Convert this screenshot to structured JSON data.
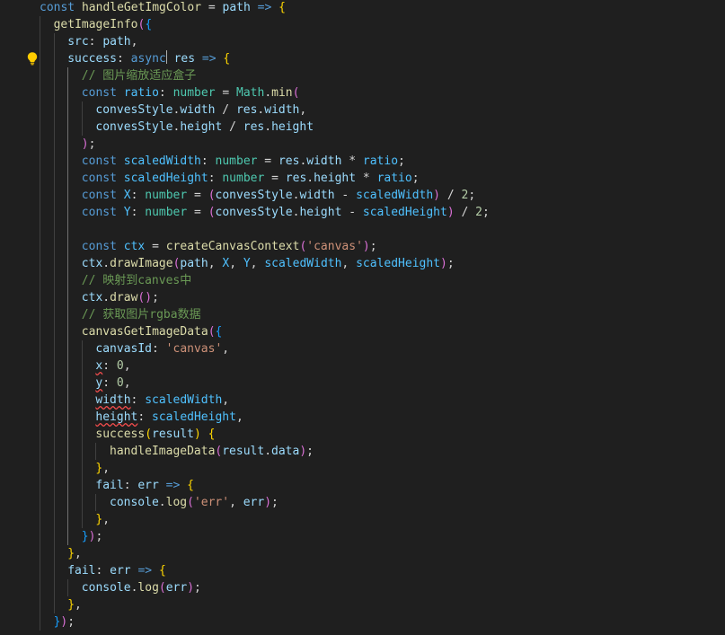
{
  "editor": {
    "theme": "dark",
    "colors": {
      "background": "#1f1f1f",
      "keyword": "#569cd6",
      "function": "#dcdcaa",
      "variable": "#9cdcfe",
      "string": "#ce9178",
      "number": "#b5cea8",
      "comment": "#6a9955",
      "type": "#4ec9b0",
      "bracket_level_1": "#ffd700",
      "bracket_level_2": "#da70d6",
      "bracket_level_3": "#179fff"
    },
    "gutter_icon": "lightbulb-icon",
    "lines": [
      {
        "indent": 0,
        "t": [
          [
            "kw",
            "const "
          ],
          [
            "fn",
            "handleGetImgColor"
          ],
          [
            "op",
            " = "
          ],
          [
            "var",
            "path"
          ],
          [
            "kw",
            " => "
          ],
          [
            "b1",
            "{"
          ]
        ]
      },
      {
        "indent": 1,
        "t": [
          [
            "fn",
            "getImageInfo"
          ],
          [
            "b2",
            "("
          ],
          [
            "b3",
            "{"
          ]
        ]
      },
      {
        "indent": 2,
        "t": [
          [
            "var",
            "src"
          ],
          [
            "op",
            ": "
          ],
          [
            "var",
            "path"
          ],
          [
            "op",
            ","
          ]
        ]
      },
      {
        "indent": 2,
        "t": [
          [
            "var",
            "success"
          ],
          [
            "op",
            ": "
          ],
          [
            "kw",
            "async"
          ],
          [
            "cur",
            ""
          ],
          [
            "op",
            " "
          ],
          [
            "var",
            "res"
          ],
          [
            "kw",
            " => "
          ],
          [
            "b1",
            "{"
          ]
        ]
      },
      {
        "indent": 3,
        "t": [
          [
            "cm",
            "// 图片缩放适应盒子"
          ]
        ]
      },
      {
        "indent": 3,
        "t": [
          [
            "kw",
            "const "
          ],
          [
            "const",
            "ratio"
          ],
          [
            "op",
            ": "
          ],
          [
            "type",
            "number"
          ],
          [
            "op",
            " = "
          ],
          [
            "type",
            "Math"
          ],
          [
            "op",
            "."
          ],
          [
            "fn",
            "min"
          ],
          [
            "b2",
            "("
          ]
        ]
      },
      {
        "indent": 4,
        "t": [
          [
            "var",
            "convesStyle"
          ],
          [
            "op",
            "."
          ],
          [
            "var",
            "width"
          ],
          [
            "op",
            " / "
          ],
          [
            "var",
            "res"
          ],
          [
            "op",
            "."
          ],
          [
            "var",
            "width"
          ],
          [
            "op",
            ","
          ]
        ]
      },
      {
        "indent": 4,
        "t": [
          [
            "var",
            "convesStyle"
          ],
          [
            "op",
            "."
          ],
          [
            "var",
            "height"
          ],
          [
            "op",
            " / "
          ],
          [
            "var",
            "res"
          ],
          [
            "op",
            "."
          ],
          [
            "var",
            "height"
          ]
        ]
      },
      {
        "indent": 3,
        "t": [
          [
            "b2",
            ")"
          ],
          [
            "op",
            ";"
          ]
        ]
      },
      {
        "indent": 3,
        "t": [
          [
            "kw",
            "const "
          ],
          [
            "const",
            "scaledWidth"
          ],
          [
            "op",
            ": "
          ],
          [
            "type",
            "number"
          ],
          [
            "op",
            " = "
          ],
          [
            "var",
            "res"
          ],
          [
            "op",
            "."
          ],
          [
            "var",
            "width"
          ],
          [
            "op",
            " * "
          ],
          [
            "const",
            "ratio"
          ],
          [
            "op",
            ";"
          ]
        ]
      },
      {
        "indent": 3,
        "t": [
          [
            "kw",
            "const "
          ],
          [
            "const",
            "scaledHeight"
          ],
          [
            "op",
            ": "
          ],
          [
            "type",
            "number"
          ],
          [
            "op",
            " = "
          ],
          [
            "var",
            "res"
          ],
          [
            "op",
            "."
          ],
          [
            "var",
            "height"
          ],
          [
            "op",
            " * "
          ],
          [
            "const",
            "ratio"
          ],
          [
            "op",
            ";"
          ]
        ]
      },
      {
        "indent": 3,
        "t": [
          [
            "kw",
            "const "
          ],
          [
            "const",
            "X"
          ],
          [
            "op",
            ": "
          ],
          [
            "type",
            "number"
          ],
          [
            "op",
            " = "
          ],
          [
            "b2",
            "("
          ],
          [
            "var",
            "convesStyle"
          ],
          [
            "op",
            "."
          ],
          [
            "var",
            "width"
          ],
          [
            "op",
            " - "
          ],
          [
            "const",
            "scaledWidth"
          ],
          [
            "b2",
            ")"
          ],
          [
            "op",
            " / "
          ],
          [
            "num",
            "2"
          ],
          [
            "op",
            ";"
          ]
        ]
      },
      {
        "indent": 3,
        "t": [
          [
            "kw",
            "const "
          ],
          [
            "const",
            "Y"
          ],
          [
            "op",
            ": "
          ],
          [
            "type",
            "number"
          ],
          [
            "op",
            " = "
          ],
          [
            "b2",
            "("
          ],
          [
            "var",
            "convesStyle"
          ],
          [
            "op",
            "."
          ],
          [
            "var",
            "height"
          ],
          [
            "op",
            " - "
          ],
          [
            "const",
            "scaledHeight"
          ],
          [
            "b2",
            ")"
          ],
          [
            "op",
            " / "
          ],
          [
            "num",
            "2"
          ],
          [
            "op",
            ";"
          ]
        ]
      },
      {
        "indent": 3,
        "t": []
      },
      {
        "indent": 3,
        "t": [
          [
            "kw",
            "const "
          ],
          [
            "const",
            "ctx"
          ],
          [
            "op",
            " = "
          ],
          [
            "fn",
            "createCanvasContext"
          ],
          [
            "b2",
            "("
          ],
          [
            "str",
            "'canvas'"
          ],
          [
            "b2",
            ")"
          ],
          [
            "op",
            ";"
          ]
        ]
      },
      {
        "indent": 3,
        "t": [
          [
            "var",
            "ctx"
          ],
          [
            "op",
            "."
          ],
          [
            "fn",
            "drawImage"
          ],
          [
            "b2",
            "("
          ],
          [
            "var",
            "path"
          ],
          [
            "op",
            ", "
          ],
          [
            "const",
            "X"
          ],
          [
            "op",
            ", "
          ],
          [
            "const",
            "Y"
          ],
          [
            "op",
            ", "
          ],
          [
            "const",
            "scaledWidth"
          ],
          [
            "op",
            ", "
          ],
          [
            "const",
            "scaledHeight"
          ],
          [
            "b2",
            ")"
          ],
          [
            "op",
            ";"
          ]
        ]
      },
      {
        "indent": 3,
        "t": [
          [
            "cm",
            "// 映射到canves中"
          ]
        ]
      },
      {
        "indent": 3,
        "t": [
          [
            "var",
            "ctx"
          ],
          [
            "op",
            "."
          ],
          [
            "fn",
            "draw"
          ],
          [
            "b2",
            "()"
          ],
          [
            "op",
            ";"
          ]
        ]
      },
      {
        "indent": 3,
        "t": [
          [
            "cm",
            "// 获取图片rgba数据"
          ]
        ]
      },
      {
        "indent": 3,
        "t": [
          [
            "fn",
            "canvasGetImageData"
          ],
          [
            "b2",
            "("
          ],
          [
            "b3",
            "{"
          ]
        ]
      },
      {
        "indent": 4,
        "t": [
          [
            "var",
            "canvasId"
          ],
          [
            "op",
            ": "
          ],
          [
            "str",
            "'canvas'"
          ],
          [
            "op",
            ","
          ]
        ]
      },
      {
        "indent": 4,
        "t": [
          [
            "sq",
            "x"
          ],
          [
            "op",
            ": "
          ],
          [
            "num",
            "0"
          ],
          [
            "op",
            ","
          ]
        ]
      },
      {
        "indent": 4,
        "t": [
          [
            "sq",
            "y"
          ],
          [
            "op",
            ": "
          ],
          [
            "num",
            "0"
          ],
          [
            "op",
            ","
          ]
        ]
      },
      {
        "indent": 4,
        "t": [
          [
            "sq",
            "width"
          ],
          [
            "op",
            ": "
          ],
          [
            "const",
            "scaledWidth"
          ],
          [
            "op",
            ","
          ]
        ]
      },
      {
        "indent": 4,
        "t": [
          [
            "sq",
            "height"
          ],
          [
            "op",
            ": "
          ],
          [
            "const",
            "scaledHeight"
          ],
          [
            "op",
            ","
          ]
        ]
      },
      {
        "indent": 4,
        "t": [
          [
            "fn",
            "success"
          ],
          [
            "b1",
            "("
          ],
          [
            "var",
            "result"
          ],
          [
            "b1",
            ")"
          ],
          [
            "op",
            " "
          ],
          [
            "b1",
            "{"
          ]
        ]
      },
      {
        "indent": 5,
        "t": [
          [
            "fn",
            "handleImageData"
          ],
          [
            "b2",
            "("
          ],
          [
            "var",
            "result"
          ],
          [
            "op",
            "."
          ],
          [
            "var",
            "data"
          ],
          [
            "b2",
            ")"
          ],
          [
            "op",
            ";"
          ]
        ]
      },
      {
        "indent": 4,
        "t": [
          [
            "b1",
            "}"
          ],
          [
            "op",
            ","
          ]
        ]
      },
      {
        "indent": 4,
        "t": [
          [
            "var",
            "fail"
          ],
          [
            "op",
            ": "
          ],
          [
            "var",
            "err"
          ],
          [
            "kw",
            " => "
          ],
          [
            "b1",
            "{"
          ]
        ]
      },
      {
        "indent": 5,
        "t": [
          [
            "var",
            "console"
          ],
          [
            "op",
            "."
          ],
          [
            "fn",
            "log"
          ],
          [
            "b2",
            "("
          ],
          [
            "str",
            "'err'"
          ],
          [
            "op",
            ", "
          ],
          [
            "var",
            "err"
          ],
          [
            "b2",
            ")"
          ],
          [
            "op",
            ";"
          ]
        ]
      },
      {
        "indent": 4,
        "t": [
          [
            "b1",
            "}"
          ],
          [
            "op",
            ","
          ]
        ]
      },
      {
        "indent": 3,
        "t": [
          [
            "b3",
            "}"
          ],
          [
            "b2",
            ")"
          ],
          [
            "op",
            ";"
          ]
        ]
      },
      {
        "indent": 2,
        "t": [
          [
            "b1",
            "}"
          ],
          [
            "op",
            ","
          ]
        ]
      },
      {
        "indent": 2,
        "t": [
          [
            "var",
            "fail"
          ],
          [
            "op",
            ": "
          ],
          [
            "var",
            "err"
          ],
          [
            "kw",
            " => "
          ],
          [
            "b1",
            "{"
          ]
        ]
      },
      {
        "indent": 3,
        "t": [
          [
            "var",
            "console"
          ],
          [
            "op",
            "."
          ],
          [
            "fn",
            "log"
          ],
          [
            "b2",
            "("
          ],
          [
            "var",
            "err"
          ],
          [
            "b2",
            ")"
          ],
          [
            "op",
            ";"
          ]
        ]
      },
      {
        "indent": 2,
        "t": [
          [
            "b1",
            "}"
          ],
          [
            "op",
            ","
          ]
        ]
      },
      {
        "indent": 1,
        "t": [
          [
            "b3",
            "}"
          ],
          [
            "b2",
            ")"
          ],
          [
            "op",
            ";"
          ]
        ]
      }
    ]
  }
}
